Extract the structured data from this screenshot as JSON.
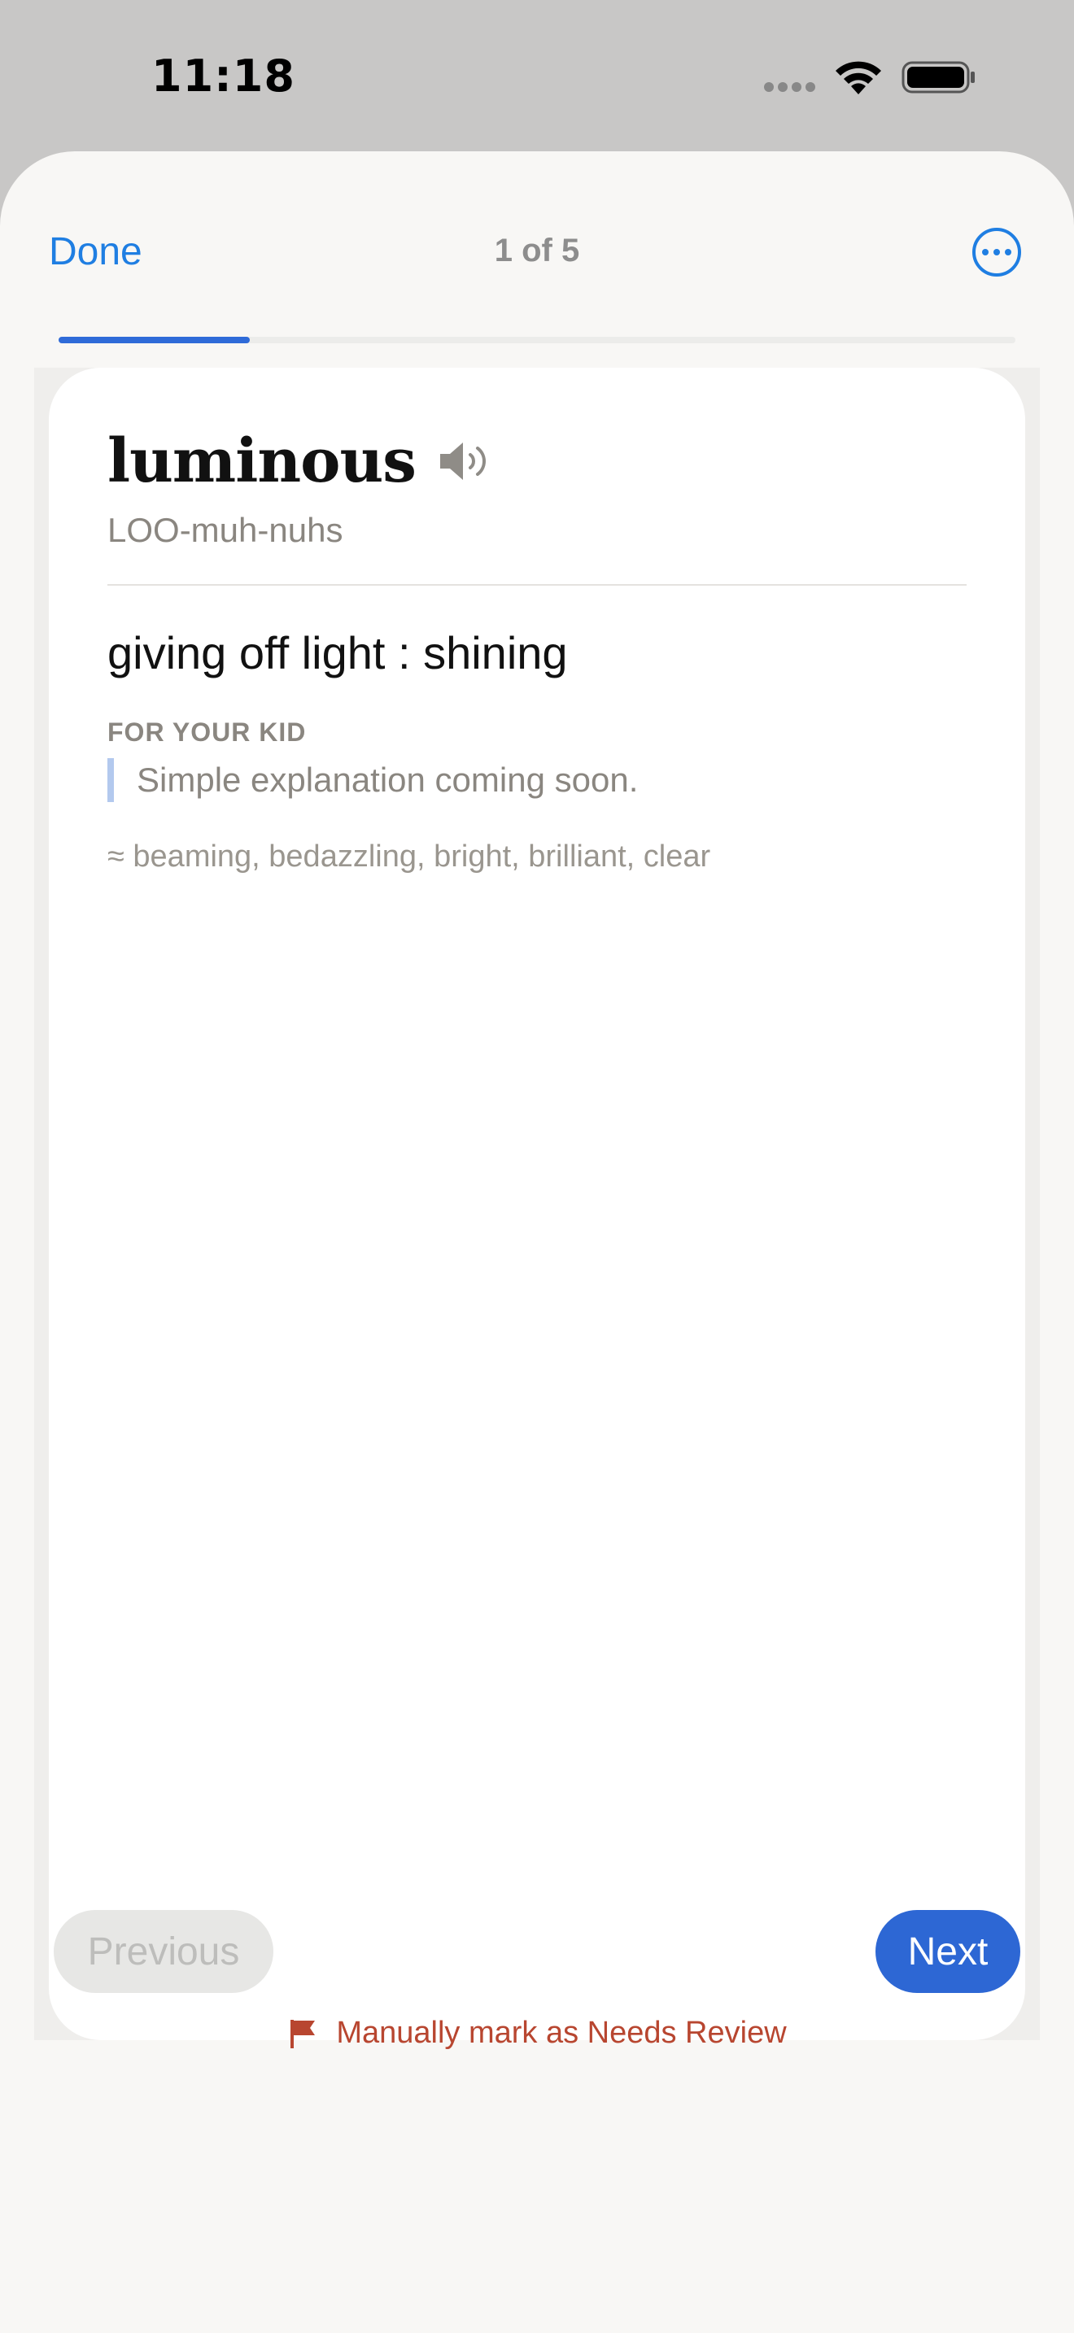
{
  "status_bar": {
    "time": "11:18",
    "icons": [
      "cellular-signal-icon",
      "wifi-icon",
      "battery-icon"
    ]
  },
  "header": {
    "done_label": "Done",
    "counter": "1 of 5",
    "more_icon": "ellipsis-circle-icon",
    "progress_fraction": 0.2
  },
  "card": {
    "word": "luminous",
    "speaker_icon": "speaker-icon",
    "pronunciation": "LOO-muh-nuhs",
    "definition": "giving off light : shining",
    "kid_label": "FOR YOUR KID",
    "kid_explanation": "Simple explanation coming soon.",
    "synonyms": "≈ beaming, bedazzling, bright, brilliant, clear"
  },
  "footer": {
    "previous_label": "Previous",
    "next_label": "Next",
    "review_label": "Manually mark as Needs Review",
    "review_icon": "flag-icon"
  },
  "colors": {
    "accent": "#1f7ee2",
    "next_button": "#2d67d4",
    "review": "#b84630"
  }
}
